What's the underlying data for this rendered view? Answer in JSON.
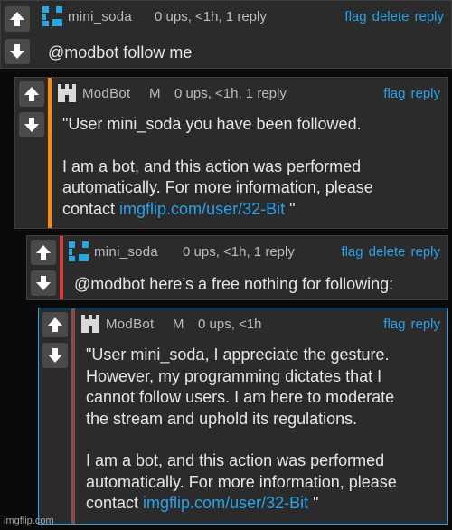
{
  "comments": [
    {
      "username": "mini_soda",
      "meta": "0 ups, <1h, 1 reply",
      "actions": [
        "flag",
        "delete",
        "reply"
      ],
      "text": "@modbot follow me"
    },
    {
      "username": "ModBot",
      "badge": "M",
      "meta": "0 ups, <1h, 1 reply",
      "actions": [
        "flag",
        "reply"
      ],
      "line1": "\"User mini_soda you have been followed.",
      "line2a": "I am a bot, and this action was performed",
      "line2b": "automatically. For more information, please",
      "contact_prefix": "contact ",
      "contact_link": "imgflip.com/user/32-Bit",
      "contact_suffix": " \""
    },
    {
      "username": "mini_soda",
      "meta": "0 ups, <1h, 1 reply",
      "actions": [
        "flag",
        "delete",
        "reply"
      ],
      "text": "@modbot here’s a free nothing for following:"
    },
    {
      "username": "ModBot",
      "badge": "M",
      "meta": "0 ups, <1h",
      "actions": [
        "flag",
        "reply"
      ],
      "p1": [
        "\"User mini_soda, I appreciate the gesture.",
        "However, my programming dictates that I",
        "cannot follow users. I am here to moderate",
        "the stream and uphold its regulations."
      ],
      "p2a": "I am a bot, and this action was performed",
      "p2b": "automatically. For more information, please",
      "contact_prefix": "contact ",
      "contact_link": "imgflip.com/user/32-Bit",
      "contact_suffix": " \""
    }
  ],
  "watermark": "imgflip.com",
  "colors": {
    "accent_orange": "#ff8c00",
    "accent_red": "#d83b3b",
    "accent_brownred": "#8b4a4a",
    "link": "#2aa1e8",
    "mini_soda_avatar": "#29a8e0",
    "modbot_avatar": "#d9d9d9"
  },
  "icons": [
    "upvote-arrow-icon",
    "downvote-arrow-icon",
    "pixel-avatar-icon",
    "castle-tower-icon"
  ]
}
